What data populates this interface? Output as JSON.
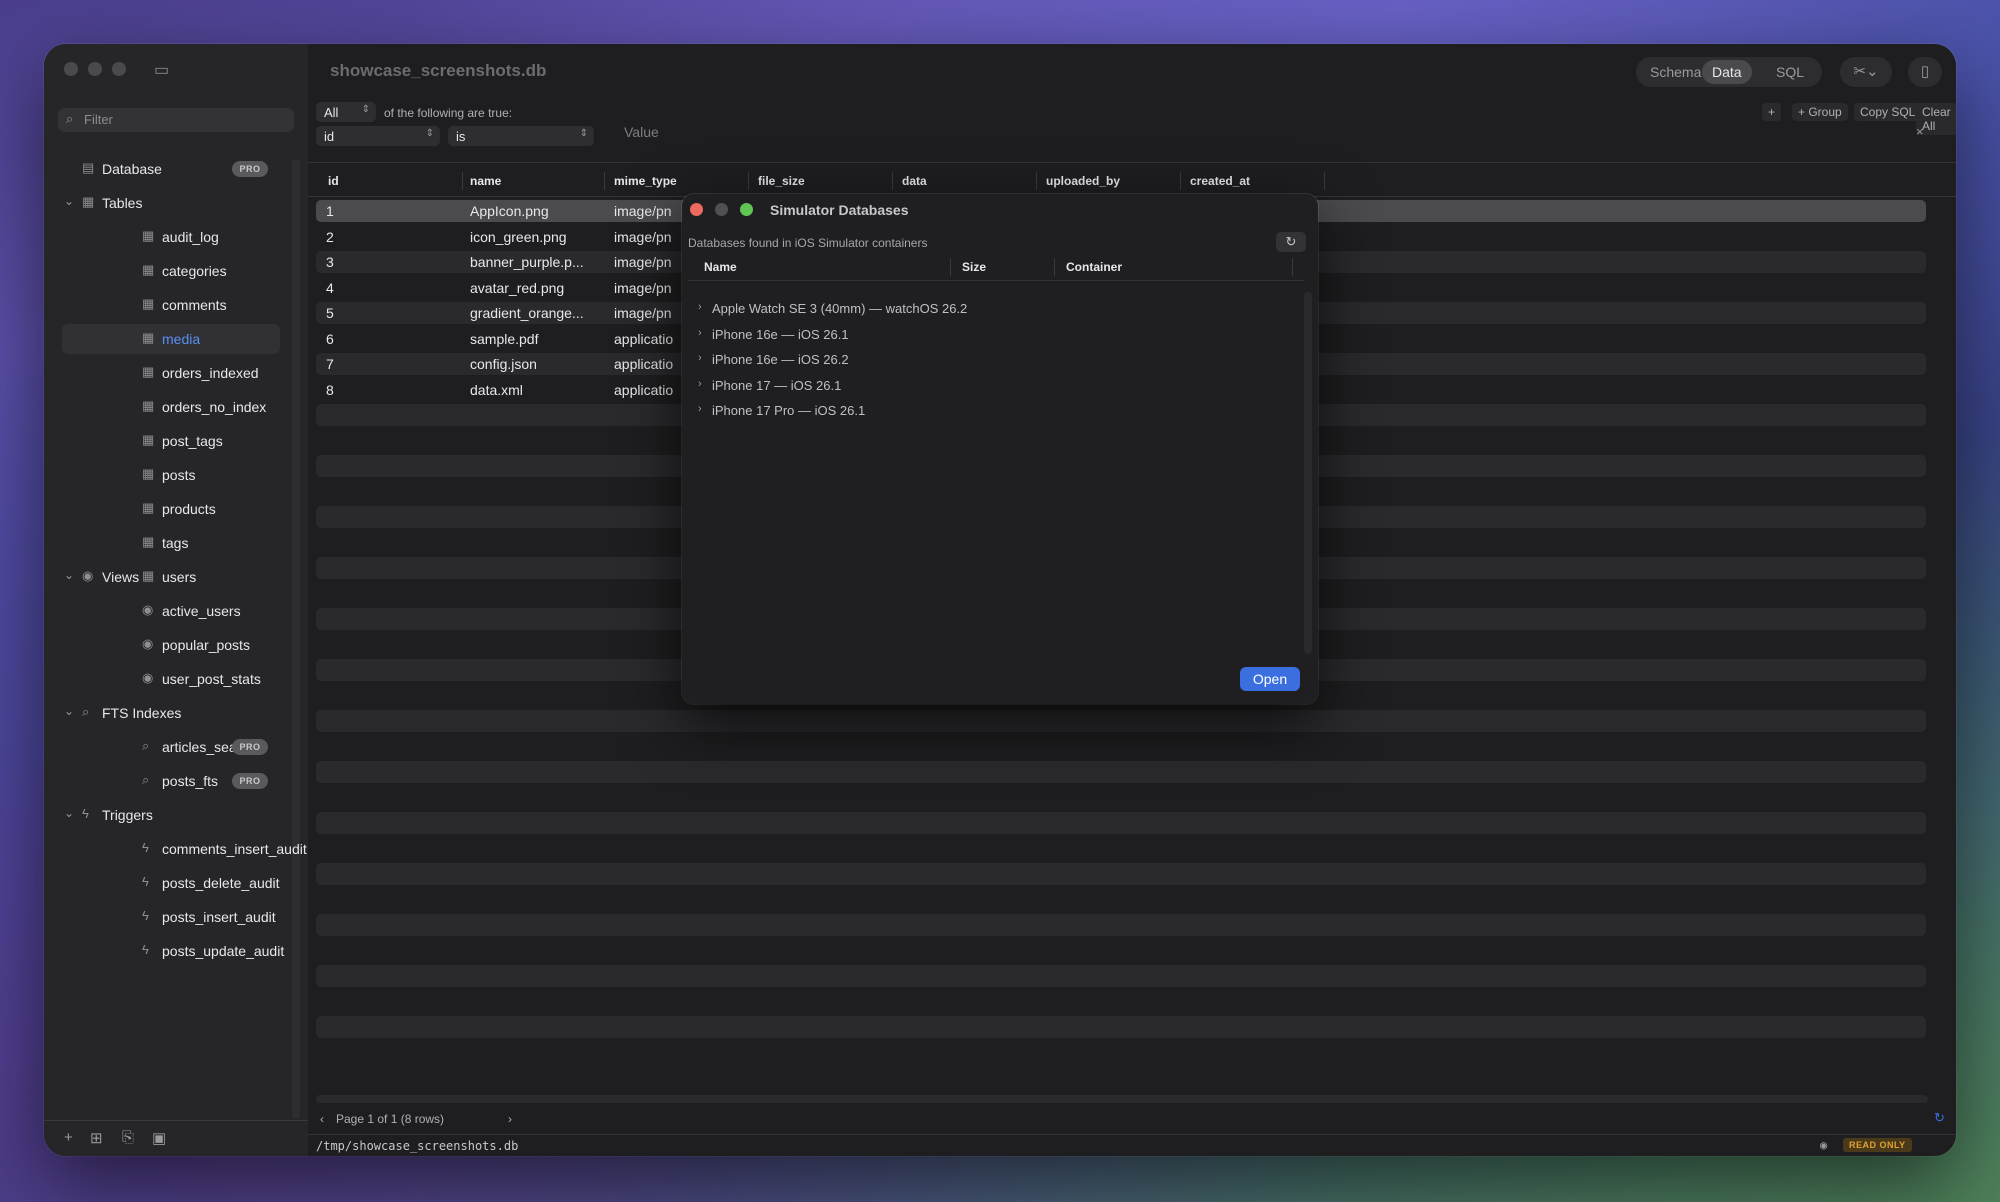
{
  "window": {
    "title": "showcase_screenshots.db"
  },
  "sidebar": {
    "filter_placeholder": "Filter",
    "database_label": "Database",
    "pro_badge": "PRO",
    "sections": {
      "tables": "Tables",
      "views": "Views",
      "fts": "FTS Indexes",
      "triggers": "Triggers"
    },
    "tables": [
      "audit_log",
      "categories",
      "comments",
      "media",
      "orders_indexed",
      "orders_no_index",
      "post_tags",
      "posts",
      "products",
      "tags",
      "users"
    ],
    "views": [
      "active_users",
      "popular_posts",
      "user_post_stats"
    ],
    "fts": [
      "articles_search",
      "posts_fts"
    ],
    "triggers": [
      "comments_insert_audit",
      "posts_delete_audit",
      "posts_insert_audit",
      "posts_update_audit"
    ],
    "selected": "media"
  },
  "toolbar": {
    "schema": "Schema",
    "data": "Data",
    "sql": "SQL"
  },
  "filter": {
    "match": "All",
    "match_suffix": "of the following are true:",
    "field": "id",
    "operator": "is",
    "value_placeholder": "Value",
    "plus": "+",
    "group": "+ Group",
    "copy_sql": "Copy SQL",
    "clear_all": "Clear All",
    "remove": "×"
  },
  "table": {
    "columns": [
      "id",
      "name",
      "mime_type",
      "file_size",
      "data",
      "uploaded_by",
      "created_at"
    ],
    "rows": [
      {
        "id": "1",
        "name": "AppIcon.png",
        "mime": "image/pn"
      },
      {
        "id": "2",
        "name": "icon_green.png",
        "mime": "image/pn"
      },
      {
        "id": "3",
        "name": "banner_purple.p...",
        "mime": "image/pn"
      },
      {
        "id": "4",
        "name": "avatar_red.png",
        "mime": "image/pn"
      },
      {
        "id": "5",
        "name": "gradient_orange...",
        "mime": "image/pn"
      },
      {
        "id": "6",
        "name": "sample.pdf",
        "mime": "applicatio"
      },
      {
        "id": "7",
        "name": "config.json",
        "mime": "applicatio"
      },
      {
        "id": "8",
        "name": "data.xml",
        "mime": "applicatio"
      }
    ]
  },
  "pager": {
    "text": "Page 1 of 1 (8 rows)",
    "prev": "‹",
    "next": "›"
  },
  "status": {
    "path": "/tmp/showcase_screenshots.db",
    "readonly": "READ ONLY"
  },
  "dialog": {
    "title": "Simulator Databases",
    "subtitle": "Databases found in iOS Simulator containers",
    "columns": [
      "Name",
      "Size",
      "Container"
    ],
    "items": [
      "Apple Watch SE 3 (40mm) — watchOS 26.2",
      "iPhone 16e — iOS 26.1",
      "iPhone 16e — iOS 26.2",
      "iPhone 17 — iOS 26.1",
      "iPhone 17 Pro — iOS 26.1"
    ],
    "open": "Open"
  },
  "colors": {
    "accent": "#3b6fe0",
    "close": "#ec6a5e",
    "minimize": "#505054",
    "zoom": "#61c554"
  }
}
